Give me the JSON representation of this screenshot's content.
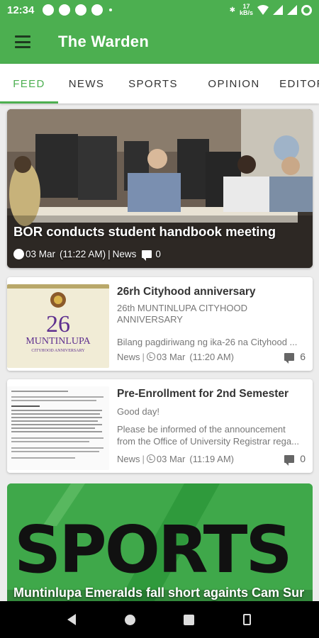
{
  "status_bar": {
    "time": "12:34",
    "net_speed_value": "17",
    "net_speed_unit": "kB/s"
  },
  "app_bar": {
    "title": "The Warden"
  },
  "tabs": [
    {
      "label": "FEED",
      "active": true
    },
    {
      "label": "NEWS",
      "active": false
    },
    {
      "label": "SPORTS",
      "active": false
    },
    {
      "label": "OPINION",
      "active": false
    },
    {
      "label": "EDITORIA",
      "active": false
    }
  ],
  "feed": {
    "hero": {
      "title": "BOR conducts student handbook meeting",
      "date": "03 Mar",
      "time": "(11:22 AM)",
      "category": "News",
      "comments": "0"
    },
    "items": [
      {
        "title": "26rh Cityhood anniversary",
        "subtitle": "26th MUNTINLUPA CITYHOOD ANNIVERSARY",
        "excerpt": "Bilang pagdiriwang ng ika-26 na Cityhood ...",
        "category": "News",
        "date": "03 Mar",
        "time": "(11:20 AM)",
        "comments": "6",
        "thumb_number": "26",
        "thumb_caption": "MUNTINLUPA",
        "thumb_caption2": "CITYHOOD ANNIVERSARY"
      },
      {
        "title": "Pre-Enrollment for 2nd Semester",
        "subtitle": "Good day!",
        "excerpt": "Please be informed of the announcement from the Office of University Registrar rega...",
        "category": "News",
        "date": "03 Mar",
        "time": "(11:19 AM)",
        "comments": "0"
      }
    ],
    "sports": {
      "banner_word": "SPORTS",
      "title": "Muntinlupa Emeralds fall short againts Cam Sur"
    }
  },
  "colors": {
    "primary": "#4caf50",
    "dark_icon": "#1e3a1f"
  }
}
